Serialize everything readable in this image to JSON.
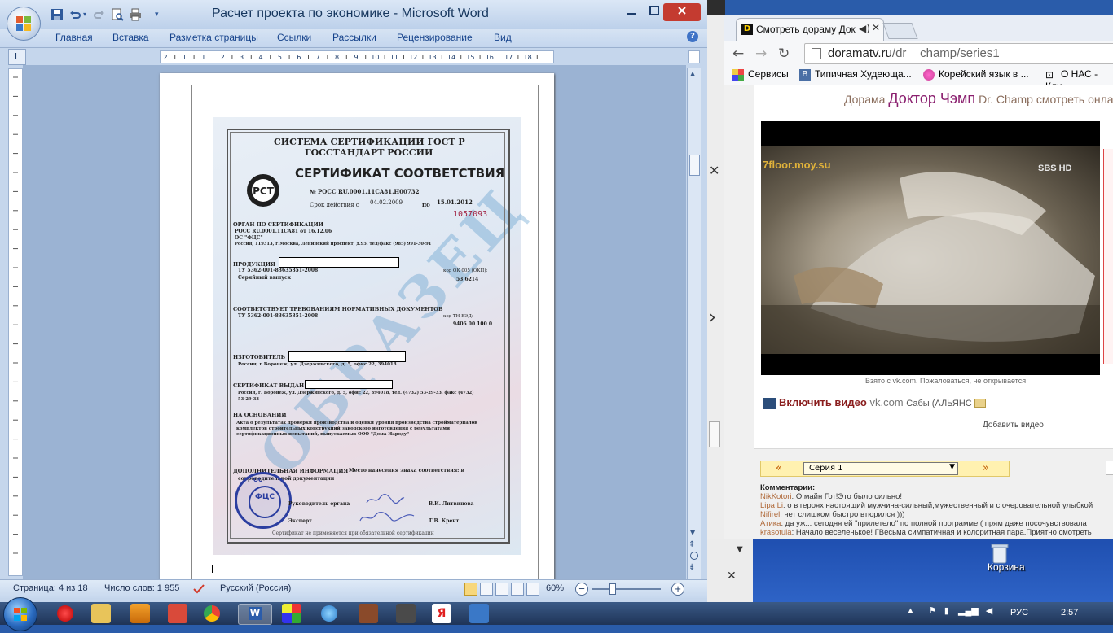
{
  "word": {
    "title": "Расчет проекта по экономике - Microsoft Word",
    "tabs": [
      "Главная",
      "Вставка",
      "Разметка страницы",
      "Ссылки",
      "Рассылки",
      "Рецензирование",
      "Вид"
    ],
    "ruler_numbers": [
      "2",
      "1",
      "1",
      "2",
      "3",
      "4",
      "5",
      "6",
      "7",
      "8",
      "9",
      "10",
      "11",
      "12",
      "13",
      "14",
      "15",
      "16",
      "17",
      "18"
    ],
    "status": {
      "page": "Страница: 4 из 18",
      "words": "Число слов: 1 955",
      "language": "Русский (Россия)",
      "zoom": "60%"
    },
    "certificate": {
      "system_line1": "СИСТЕМА СЕРТИФИКАЦИИ ГОСТ Р",
      "system_line2": "ГОССТАНДАРТ РОССИИ",
      "title": "СЕРТИФИКАТ СООТВЕТСТВИЯ",
      "logo_text": "РСТ",
      "number": "№  РОСС RU.0001.11CA81.H00732",
      "validity_label": "Срок действия  с",
      "valid_from": "04.02.2009",
      "valid_to_label": "по",
      "valid_to": "15.01.2012",
      "serial": "1057093",
      "organ_header": "ОРГАН ПО СЕРТИФИКАЦИИ",
      "organ_line1": "РОСС RU.0001.11CA81 от 16.12.06",
      "organ_line2": "ОС \"ФЦС\"",
      "organ_line3": "Россия, 119313, г.Москва, Ленинский проспект, д.95, тел/факс (985) 991-30-91",
      "product_label": "ПРОДУКЦИЯ",
      "product_line1": "ТУ 5362-001-83635351-2008",
      "product_line2": "Серийный выпуск",
      "okp_label": "код ОК 005 (ОКП):",
      "okp_value": "53 6214",
      "conform_header": "СООТВЕТСТВУЕТ ТРЕБОВАНИЯМ НОРМАТИВНЫХ ДОКУМЕНТОВ",
      "conform_line": "ТУ 5362-001-83635351-2008",
      "tnved_label": "код ТН ВЭД:",
      "tnved_value": "9406 00 100 0",
      "manufacturer_label": "ИЗГОТОВИТЕЛЬ",
      "manufacturer_line": "Россия, г.Воронеж, ул. Дзержинского, д. 5, офис 22, 394018",
      "issued_label": "СЕРТИФИКАТ ВЫДАН",
      "issued_line1": "Россия, г. Воронеж, ул. Дзержинского, д. 5, офис 22, 394018, тел. (4732) 53-29-33, факс (4732)",
      "issued_line2": "53-29-33",
      "basis_label": "НА ОСНОВАНИИ",
      "basis_line1": "Акта о результатах проверки производства и оценки уровня производства стройматериалов",
      "basis_line2": "комплектов строительных конструкций заводского изготовления с результатами",
      "basis_line3": "сертификационных испытаний, выпускаемых ООО \"Дома Народу\"",
      "extra_label": "ДОПОЛНИТЕЛЬНАЯ ИНФОРМАЦИЯ",
      "extra_text": "Место нанесения знака соответствия: в",
      "extra_text2": "сопроводительной документации",
      "head_label": "Руководитель органа",
      "head_name": "В.И. Литвинова",
      "expert_label": "Эксперт",
      "expert_name": "Т.В. Крент",
      "footer": "Сертификат не применяется при обязательной сертификации",
      "watermark": "ОБРАЗЕЦ",
      "stamp_text": "ФЦС",
      "stamp_top": "ОС"
    }
  },
  "chrome": {
    "tab_title": "Смотреть дораму Док",
    "tab_favicon": "D",
    "url_domain": "doramatv.ru",
    "url_path": "/dr__champ/series1",
    "bookmarks": [
      "Сервисы",
      "Типичная Худеюща...",
      "Корейский язык в ...",
      "О НАС - Кли"
    ],
    "page": {
      "title_prefix": "Дорама",
      "title_main": "Доктор Чэмп",
      "title_suffix": "Dr. Champ смотреть онлайн",
      "video_watermark": "7floor.moy.su",
      "video_channel": "SBS HD",
      "video_note": "Взято с vk.com. Пожаловаться, не открывается",
      "enable_video": "Включить видео",
      "enable_source": "vk.com",
      "enable_subs": "Сабы (АЛЬЯНС",
      "add_video": "Добавить видео",
      "series_prev": "«",
      "series_next": "»",
      "series_value": "Серия 1",
      "comments_header": "Комментарии:",
      "comments": [
        {
          "user": "NikKotori",
          "text": ": О,майн Гот!Это было сильно!"
        },
        {
          "user": "Lipa Li",
          "text": ": о в героях настоящий мужчина-сильный,мужественный и с очеровательной улыбкой"
        },
        {
          "user": "Nifirel",
          "text": ": чет слишком быстро втюрился )))"
        },
        {
          "user": "Атика",
          "text": ": да уж... сегодня ей \"прилетело\" по полной программе ( прям даже посочувствовала"
        },
        {
          "user": "krasotula",
          "text": ": Начало веселенькое! ГВесьма симпатичная и колоритная пара.Приятно смотреть"
        }
      ]
    }
  },
  "desktop": {
    "recycle_label": "Корзина"
  },
  "taskbar": {
    "language": "РУС",
    "clock": "2:57"
  }
}
